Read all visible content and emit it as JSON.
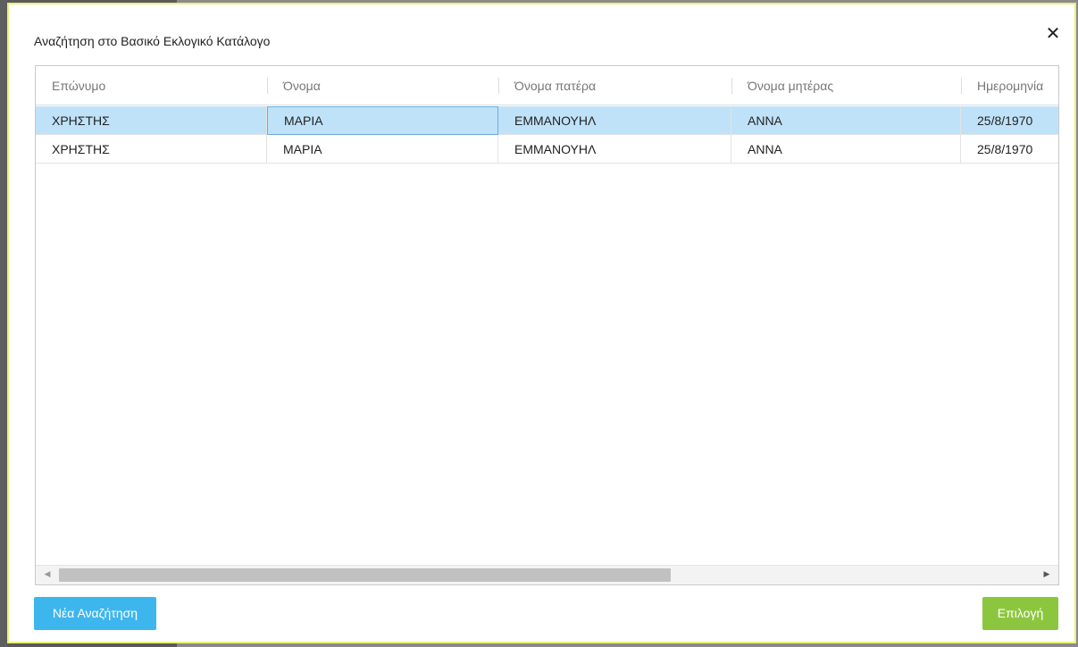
{
  "dialog": {
    "title": "Αναζήτηση στο Βασικό Εκλογικό Κατάλογο",
    "close_symbol": "✕"
  },
  "grid": {
    "columns": [
      "Επώνυμο",
      "Όνομα",
      "Όνομα πατέρα",
      "Όνομα μητέρας",
      "Ημερομηνία"
    ],
    "rows": [
      [
        "ΧΡΗΣΤΗΣ",
        "ΜΑΡΙΑ",
        "ΕΜΜΑΝΟΥΗΛ",
        "ΑΝΝΑ",
        "25/8/1970"
      ],
      [
        "ΧΡΗΣΤΗΣ",
        "ΜΑΡΙΑ",
        "ΕΜΜΑΝΟΥΗΛ",
        "ΑΝΝΑ",
        "25/8/1970"
      ]
    ]
  },
  "buttons": {
    "new_search": "Νέα Αναζήτηση",
    "select": "Επιλογή"
  },
  "colors": {
    "selected_row": "#bfe2f8",
    "new_search_button": "#3db6ee",
    "select_button": "#8cc63e"
  }
}
